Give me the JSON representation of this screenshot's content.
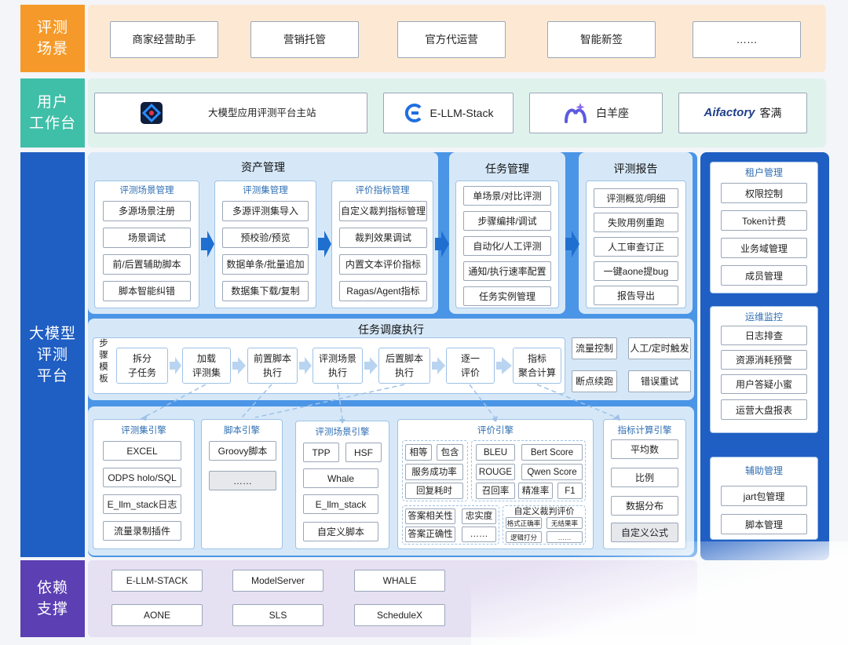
{
  "rows": {
    "scene": {
      "label": "评测\n场景",
      "color": "#f59a2a",
      "items": [
        "商家经营助手",
        "营销托管",
        "官方代运营",
        "智能新签",
        "……"
      ]
    },
    "workbench": {
      "label": "用户\n工作台",
      "color": "#3fbfa8",
      "items": [
        "大模型应用评测平台主站",
        "E-LLM-Stack",
        "白羊座",
        "客满"
      ],
      "aifactory_logo": "Aifactory",
      "icons": [
        "platform-logo-icon",
        "e-llm-stack-logo-icon",
        "baiyangzuo-logo-icon",
        "aifactory-logo-icon"
      ]
    },
    "platform": {
      "label": "大模型\n评测\n平台",
      "color": "#1f5ec3"
    },
    "support": {
      "label": "依赖\n支撑",
      "color": "#5b3fb3",
      "items": [
        "E-LLM-STACK",
        "ModelServer",
        "WHALE",
        "AONE",
        "SLS",
        "ScheduleX"
      ]
    }
  },
  "asset_mgmt": {
    "title": "资产管理",
    "groups": [
      {
        "title": "评测场景管理",
        "items": [
          "多源场景注册",
          "场景调试",
          "前/后置辅助脚本",
          "脚本智能纠错"
        ]
      },
      {
        "title": "评测集管理",
        "items": [
          "多源评测集导入",
          "预校验/预览",
          "数据单条/批量追加",
          "数据集下载/复制"
        ]
      },
      {
        "title": "评价指标管理",
        "items": [
          "自定义裁判指标管理",
          "裁判效果调试",
          "内置文本评价指标",
          "Ragas/Agent指标"
        ]
      }
    ]
  },
  "task_mgmt": {
    "title": "任务管理",
    "items": [
      "单场景/对比评测",
      "步骤编排/调试",
      "自动化/人工评测",
      "通知/执行速率配置",
      "任务实例管理"
    ]
  },
  "report": {
    "title": "评测报告",
    "items": [
      "评测概览/明细",
      "失败用例重跑",
      "人工审查订正",
      "一键aone提bug",
      "报告导出"
    ]
  },
  "scheduler": {
    "title": "任务调度执行",
    "steps_label": "步\n骤\n模\n板",
    "steps": [
      "拆分\n子任务",
      "加载\n评测集",
      "前置脚本\n执行",
      "评测场景\n执行",
      "后置脚本\n执行",
      "逐一\n评价",
      "指标\n聚合计算"
    ],
    "controls": [
      "流量控制",
      "人工/定时触发",
      "断点续跑",
      "错误重试"
    ]
  },
  "engines": {
    "dataset": {
      "title": "评测集引擎",
      "items": [
        "EXCEL",
        "ODPS holo/SQL",
        "E_llm_stack日志",
        "流量录制插件"
      ]
    },
    "script": {
      "title": "脚本引擎",
      "items": [
        "Groovy脚本",
        "……"
      ]
    },
    "scene": {
      "title": "评测场景引擎",
      "items": [
        "TPP",
        "HSF",
        "Whale",
        "E_llm_stack",
        "自定义脚本"
      ]
    },
    "eval": {
      "title": "评价引擎",
      "left": [
        "相等",
        "包含",
        "服务成功率",
        "回复耗时"
      ],
      "right": [
        "BLEU",
        "Bert Score",
        "ROUGE",
        "Qwen Score",
        "召回率",
        "精准率",
        "F1"
      ],
      "bottom_left": [
        "答案相关性",
        "忠实度",
        "答案正确性",
        "……"
      ],
      "judge_title": "自定义裁判评价",
      "judge_items": [
        "格式正确率",
        "无结果率",
        "逻辑打分",
        "……"
      ]
    },
    "metric": {
      "title": "指标计算引擎",
      "items": [
        "平均数",
        "比例",
        "数据分布",
        "自定义公式"
      ]
    }
  },
  "right": {
    "color": "#1f5ec3",
    "groups": [
      {
        "title": "租户管理",
        "items": [
          "权限控制",
          "Token计费",
          "业务域管理",
          "成员管理"
        ]
      },
      {
        "title": "运维监控",
        "items": [
          "日志排查",
          "资源消耗预警",
          "用户答疑小蜜",
          "运营大盘报表"
        ]
      },
      {
        "title": "辅助管理",
        "items": [
          "jart包管理",
          "脚本管理"
        ]
      }
    ]
  }
}
